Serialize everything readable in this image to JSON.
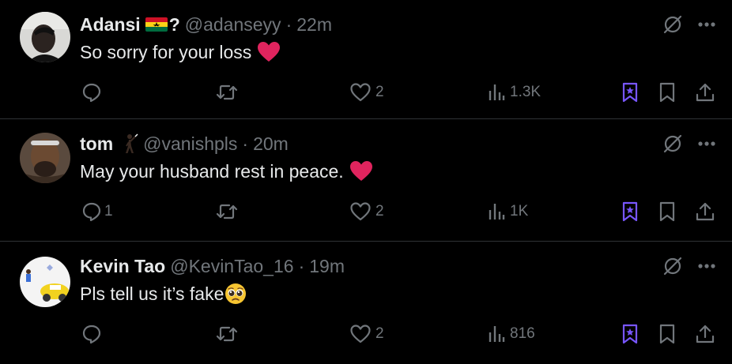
{
  "colors": {
    "background": "#000000",
    "text_primary": "#e7e9ea",
    "text_secondary": "#71767b",
    "divider": "#2f3336",
    "bookmark_accent": "#7856ff",
    "heart_red": "#e0245e"
  },
  "tweets": [
    {
      "name": "Adansi",
      "name_suffix_icons": [
        "ghana-flag-emoji"
      ],
      "name_suffix_text": "?",
      "handle": "@adanseyy",
      "separator": "·",
      "time": "22m",
      "text": "So sorry for your loss",
      "text_emoji": "red-heart-emoji",
      "actions": {
        "reply_count": "",
        "retweet_count": "",
        "like_count": "2",
        "views_count": "1.3K"
      }
    },
    {
      "name": "tom",
      "name_suffix_icons": [
        "person-emoji"
      ],
      "name_suffix_text": "",
      "handle": "@vanishpls",
      "separator": "·",
      "time": "20m",
      "text": "May your husband rest in peace.",
      "text_emoji": "red-heart-emoji",
      "actions": {
        "reply_count": "1",
        "retweet_count": "",
        "like_count": "2",
        "views_count": "1K"
      }
    },
    {
      "name": "Kevin Tao",
      "name_suffix_icons": [],
      "name_suffix_text": "",
      "handle": "@KevinTao_16",
      "separator": "·",
      "time": "19m",
      "text": "Pls tell us it’s fake",
      "text_emoji": "pleading-face-emoji",
      "actions": {
        "reply_count": "",
        "retweet_count": "",
        "like_count": "2",
        "views_count": "816"
      }
    }
  ]
}
